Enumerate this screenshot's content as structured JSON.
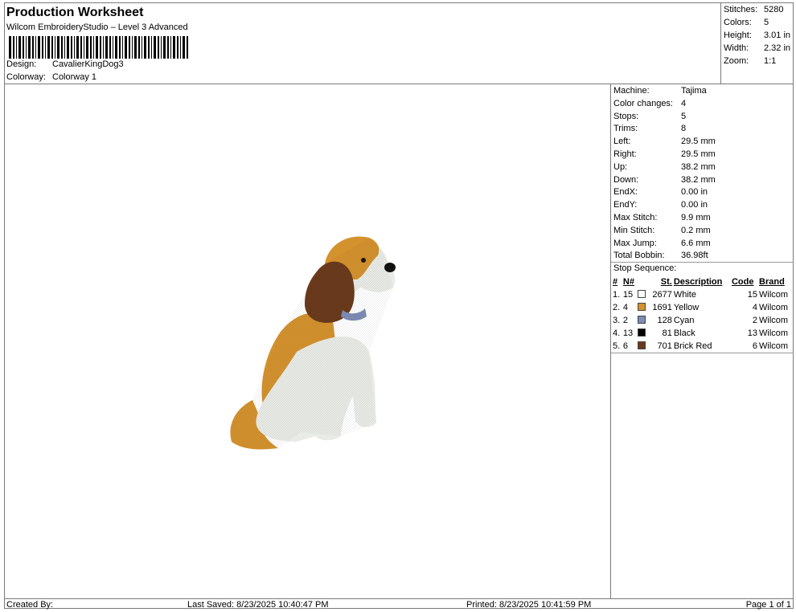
{
  "header": {
    "title": "Production Worksheet",
    "subtitle": "Wilcom EmbroideryStudio – Level 3 Advanced",
    "design_label": "Design:",
    "design_value": "CavalierKingDog3",
    "colorway_label": "Colorway:",
    "colorway_value": "Colorway 1"
  },
  "stats": [
    {
      "label": "Stitches:",
      "value": "5280"
    },
    {
      "label": "Colors:",
      "value": "5"
    },
    {
      "label": "Height:",
      "value": "3.01 in"
    },
    {
      "label": "Width:",
      "value": "2.32 in"
    },
    {
      "label": "Zoom:",
      "value": "1:1"
    }
  ],
  "machine": [
    {
      "label": "Machine:",
      "value": "Tajima"
    },
    {
      "label": "Color changes:",
      "value": "4"
    },
    {
      "label": "Stops:",
      "value": "5"
    },
    {
      "label": "Trims:",
      "value": "8"
    },
    {
      "label": "Left:",
      "value": "29.5 mm"
    },
    {
      "label": "Right:",
      "value": "29.5 mm"
    },
    {
      "label": "Up:",
      "value": "38.2 mm"
    },
    {
      "label": "Down:",
      "value": "38.2 mm"
    },
    {
      "label": "EndX:",
      "value": "0.00 in"
    },
    {
      "label": "EndY:",
      "value": "0.00 in"
    },
    {
      "label": "Max Stitch:",
      "value": "9.9 mm"
    },
    {
      "label": "Min Stitch:",
      "value": "0.2 mm"
    },
    {
      "label": "Max Jump:",
      "value": "6.6 mm"
    },
    {
      "label": "Total Bobbin:",
      "value": "36.98ft"
    }
  ],
  "stop_sequence": {
    "label": "Stop Sequence:",
    "columns": {
      "num": "#",
      "n": "N#",
      "st": "St.",
      "description": "Description",
      "code": "Code",
      "brand": "Brand"
    },
    "rows": [
      {
        "num": "1.",
        "n": "15",
        "color": "#ffffff",
        "st": "2677",
        "description": "White",
        "code": "15",
        "brand": "Wilcom"
      },
      {
        "num": "2.",
        "n": "4",
        "color": "#d4922e",
        "st": "1691",
        "description": "Yellow",
        "code": "4",
        "brand": "Wilcom"
      },
      {
        "num": "3.",
        "n": "2",
        "color": "#7d8cb5",
        "st": "128",
        "description": "Cyan",
        "code": "2",
        "brand": "Wilcom"
      },
      {
        "num": "4.",
        "n": "13",
        "color": "#000000",
        "st": "81",
        "description": "Black",
        "code": "13",
        "brand": "Wilcom"
      },
      {
        "num": "5.",
        "n": "6",
        "color": "#6b3a1c",
        "st": "701",
        "description": "Brick Red",
        "code": "6",
        "brand": "Wilcom"
      }
    ]
  },
  "footer": {
    "created_by": "Created By:",
    "last_saved": "Last Saved: 8/23/2025 10:40:47 PM",
    "printed": "Printed: 8/23/2025 10:41:59 PM",
    "page": "Page 1 of 1"
  },
  "design_preview_icon": "embroidered-cavalier-dog-image"
}
